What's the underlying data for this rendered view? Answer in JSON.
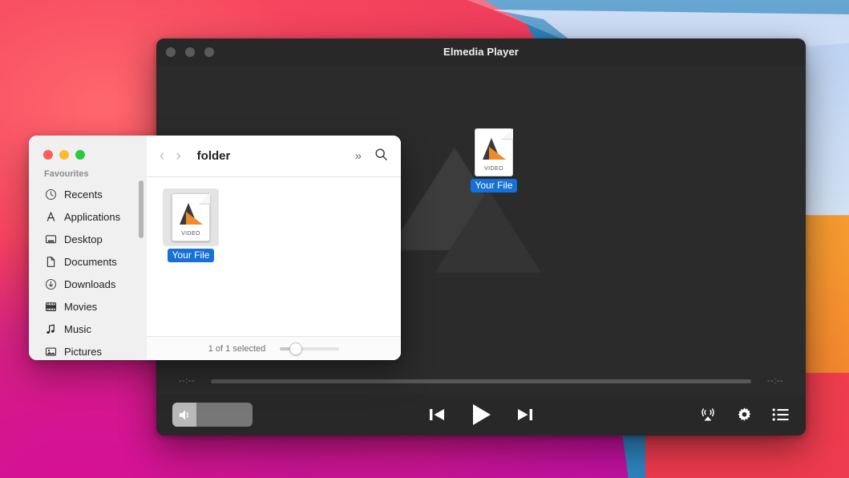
{
  "desktop": {
    "wallpaper_name": "big-sur-wallpaper",
    "colors": {
      "red": "#f2435c",
      "magenta": "#c4119b",
      "blue": "#2d84bf",
      "light_blue": "#b9cff2",
      "orange": "#f5972f"
    }
  },
  "player": {
    "title": "Elmedia Player",
    "window_controls": [
      "close",
      "minimize",
      "zoom"
    ],
    "watermark_icon": "elmedia-logo-watermark",
    "drag_ghost": {
      "file_label": "Your File",
      "file_type_label": "VIDEO",
      "icon": "video-file-icon"
    },
    "seek": {
      "current_time": "--:--",
      "total_time": "--:--",
      "progress_percent": 0
    },
    "volume": {
      "icon": "speaker-icon",
      "level_percent": 30
    },
    "controls": {
      "previous_label": "previous-track",
      "play_label": "play",
      "next_label": "next-track",
      "airplay_label": "airplay",
      "settings_label": "settings",
      "playlist_label": "playlist"
    }
  },
  "finder": {
    "window_controls": [
      "close",
      "minimize",
      "zoom"
    ],
    "toolbar": {
      "back_icon": "chevron-left-icon",
      "forward_icon": "chevron-right-icon",
      "path_title": "folder",
      "overflow_icon": "double-chevron-right-icon",
      "search_icon": "search-icon"
    },
    "sidebar": {
      "header": "Favourites",
      "items": [
        {
          "label": "Recents",
          "icon": "clock-icon"
        },
        {
          "label": "Applications",
          "icon": "applications-icon"
        },
        {
          "label": "Desktop",
          "icon": "desktop-icon"
        },
        {
          "label": "Documents",
          "icon": "document-icon"
        },
        {
          "label": "Downloads",
          "icon": "download-icon"
        },
        {
          "label": "Movies",
          "icon": "film-icon"
        },
        {
          "label": "Music",
          "icon": "music-note-icon"
        },
        {
          "label": "Pictures",
          "icon": "photo-icon"
        }
      ]
    },
    "content": {
      "file": {
        "name": "Your File",
        "type_label": "VIDEO",
        "icon": "video-file-icon",
        "selected": true
      }
    },
    "statusbar": {
      "status_text": "1 of 1 selected",
      "icon_size_slider_percent": 22
    }
  }
}
